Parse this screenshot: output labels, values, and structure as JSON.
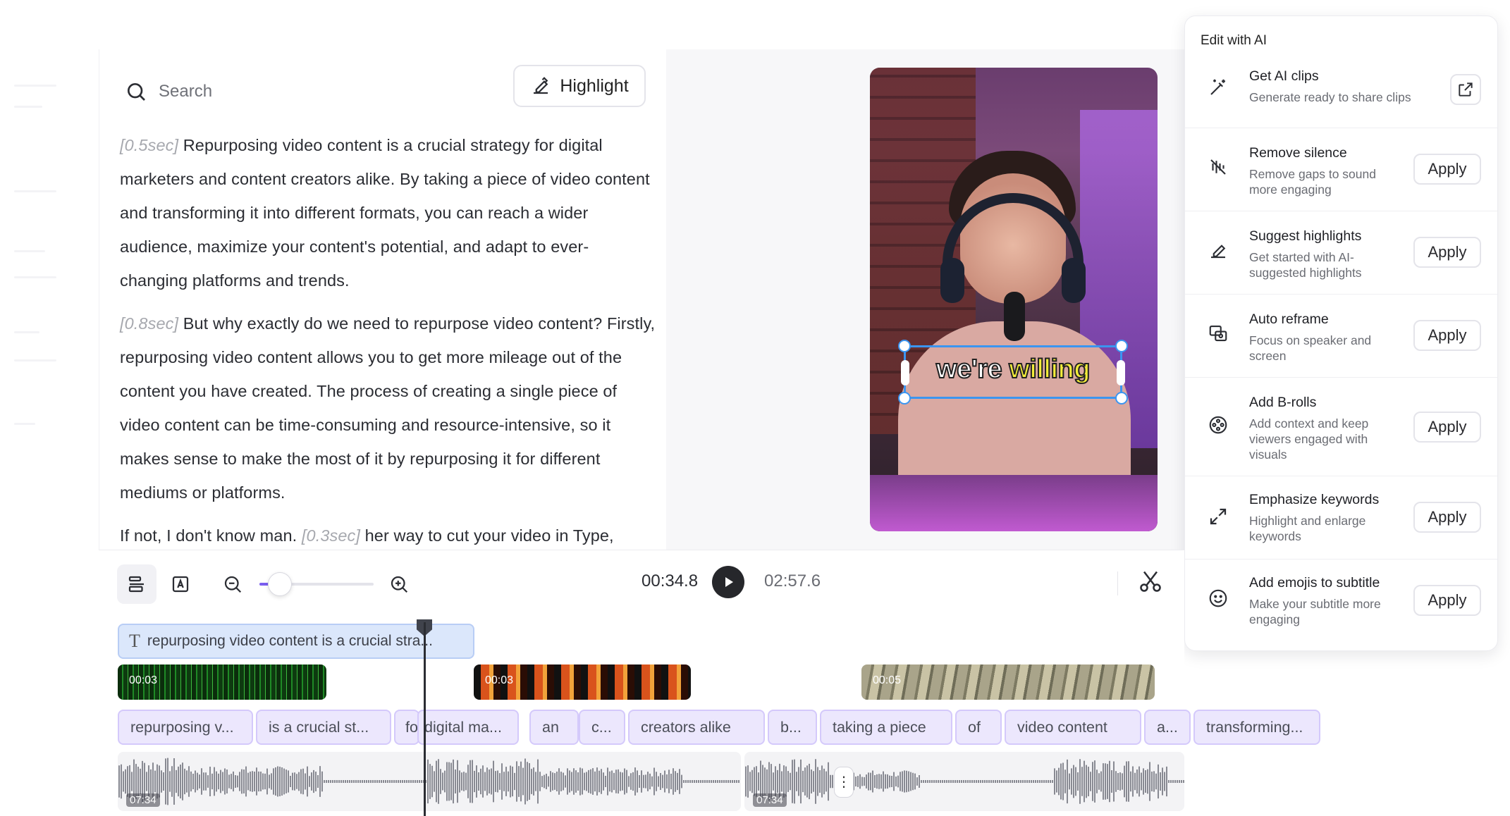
{
  "transcript": {
    "search_placeholder": "Search",
    "highlight_label": "Highlight",
    "paragraphs": [
      {
        "ts": "[0.5sec]",
        "text": " Repurposing video content is a crucial strategy for digital marketers and content creators alike. By taking a piece of video content and transforming it into different formats, you can reach a wider audience, maximize your content's potential, and adapt to ever-changing platforms and trends."
      },
      {
        "ts": "[0.8sec]",
        "text": " But why exactly do we need to repurpose video content? Firstly, repurposing video content allows you to get more mileage out of the content you have created. The process of creating a single piece of video content can be time-consuming and resource-intensive, so it makes sense to make the most of it by repurposing it for different mediums or platforms."
      },
      {
        "pre": "If not, I don't know man. ",
        "ts": "[0.3sec]",
        "text": " her way to cut your video in Type,"
      }
    ]
  },
  "preview": {
    "caption_word_1": "we're",
    "caption_word_2": "willing"
  },
  "ai_panel": {
    "title": "Edit with AI",
    "items": [
      {
        "name": "Get AI clips",
        "desc": "Generate ready to share clips",
        "icon": "magic-wand-icon",
        "action": "open"
      },
      {
        "name": "Remove silence",
        "desc": "Remove gaps to sound more engaging",
        "icon": "waveform-off-icon",
        "action": "Apply"
      },
      {
        "name": "Suggest highlights",
        "desc": "Get started with AI-suggested highlights",
        "icon": "highlighter-icon",
        "action": "Apply"
      },
      {
        "name": "Auto reframe",
        "desc": "Focus on speaker and screen",
        "icon": "reframe-icon",
        "action": "Apply"
      },
      {
        "name": "Add B-rolls",
        "desc": "Add context and keep viewers engaged with visuals",
        "icon": "film-reel-icon",
        "action": "Apply"
      },
      {
        "name": "Emphasize keywords",
        "desc": "Highlight and enlarge keywords",
        "icon": "expand-arrows-icon",
        "action": "Apply"
      },
      {
        "name": "Add emojis to subtitle",
        "desc": "Make your subtitle more engaging",
        "icon": "smiley-icon",
        "action": "Apply"
      }
    ]
  },
  "timeline": {
    "current_time": "00:34.8",
    "total_time": "02:57.6",
    "zoom_level": 0.18,
    "text_track": "repurposing video content is a crucial stra...",
    "clips": [
      "00:03",
      "00:03",
      "00:05"
    ],
    "words": [
      "repurposing v...",
      "is a crucial st...",
      "fo",
      "digital ma...",
      "an",
      "c...",
      "creators alike",
      "b...",
      "taking a piece",
      "of",
      "video content",
      "a...",
      "transforming..."
    ],
    "audio_labels": [
      "07:34",
      "07:34"
    ],
    "colors": {
      "accent": "#7a5ef0",
      "word_bg": "#ece7fd",
      "text_track_bg": "#dbe7fb"
    }
  }
}
